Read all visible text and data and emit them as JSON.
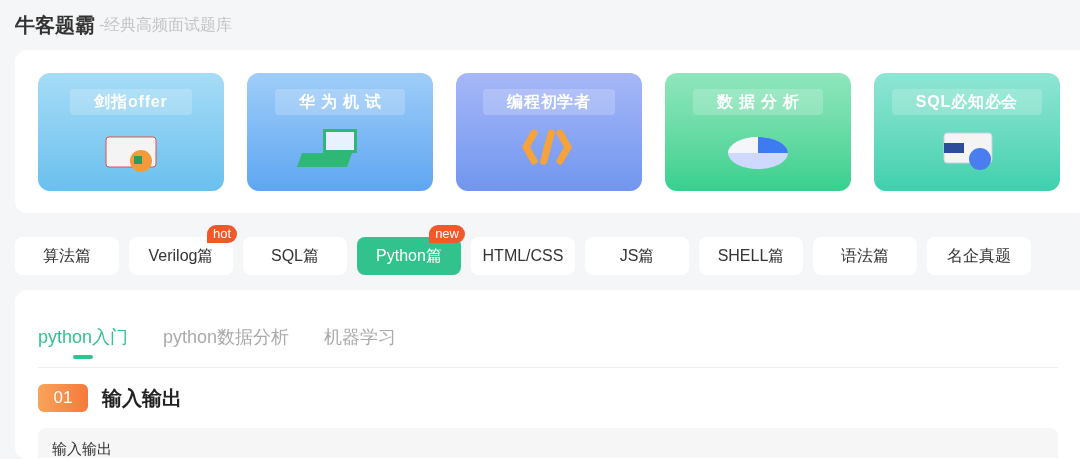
{
  "header": {
    "title": "牛客题霸",
    "subtitle": "-经典高频面试题库"
  },
  "banners": [
    {
      "title": "剑指offer"
    },
    {
      "title": "华 为 机 试"
    },
    {
      "title": "编程初学者"
    },
    {
      "title": "数 据 分 析"
    },
    {
      "title": "SQL必知必会"
    }
  ],
  "category_tabs": [
    {
      "label": "算法篇",
      "selected": false
    },
    {
      "label": "Verilog篇",
      "selected": false,
      "badge": "hot"
    },
    {
      "label": "SQL篇",
      "selected": false
    },
    {
      "label": "Python篇",
      "selected": true,
      "badge": "new"
    },
    {
      "label": "HTML/CSS",
      "selected": false
    },
    {
      "label": "JS篇",
      "selected": false
    },
    {
      "label": "SHELL篇",
      "selected": false
    },
    {
      "label": "语法篇",
      "selected": false
    },
    {
      "label": "名企真题",
      "selected": false
    }
  ],
  "sub_tabs": [
    {
      "label": "python入门",
      "selected": true
    },
    {
      "label": "python数据分析",
      "selected": false
    },
    {
      "label": "机器学习",
      "selected": false
    }
  ],
  "section": {
    "number": "01",
    "title": "输入输出",
    "item": "输入输出"
  }
}
